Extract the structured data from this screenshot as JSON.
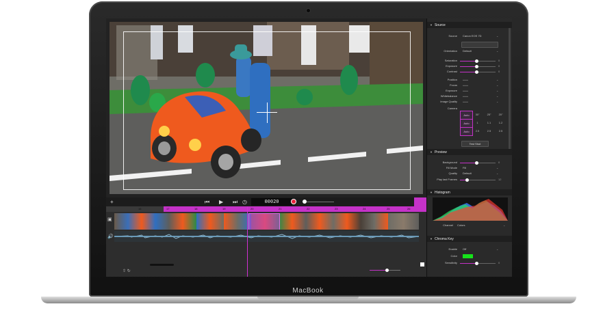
{
  "device": {
    "brand": "MacBook"
  },
  "transport": {
    "timecode": "00020",
    "prev_icon": "skip-back-icon",
    "play_icon": "play-icon",
    "next_icon": "skip-forward-icon",
    "clock_icon": "clock-icon"
  },
  "timeline": {
    "ruler_labels": [
      "16",
      "17",
      "18",
      "19",
      "20",
      "21",
      "22",
      "23",
      "24",
      "25",
      "26"
    ]
  },
  "inspector": {
    "source": {
      "title": "Source",
      "source_label": "Source",
      "source_value": "Canon EOS 7D",
      "orientation_label": "Orientation",
      "orientation_value": "Default",
      "saturation_label": "Saturation",
      "saturation_value": "0",
      "exposure_label": "Exposure",
      "exposure_value": "0",
      "contrast_label": "Contrast",
      "contrast_value": "0",
      "position_label": "Position",
      "focus_label": "Focus",
      "exposure2_label": "Exposure",
      "whitebalance_label": "Whitebalance",
      "image_quality_label": "Image Quality",
      "camera_label": "Camera",
      "camera_cells": [
        "Auto",
        "30\"",
        "25\"",
        "20\"",
        "Auto",
        "1",
        "1.1",
        "1.2",
        "Auto",
        "2.5",
        "2.5",
        "2.5"
      ],
      "test_shot": "Test Shot"
    },
    "preview": {
      "title": "Preview",
      "background_label": "Background",
      "background_value": "0",
      "fill_mode_label": "Fill Mode",
      "fill_mode_value": "Fill",
      "quality_label": "Quality",
      "quality_value": "Default",
      "play_last_label": "Play last Frames",
      "play_last_value": "12"
    },
    "histogram": {
      "title": "Histogram",
      "channel_label": "Channel",
      "channel_value": "Colors"
    },
    "chroma_key": {
      "title": "Chroma Key",
      "enable_label": "Enable",
      "enable_value": "Off",
      "color_label": "Color",
      "color_hex": "#16e21a",
      "sensitivity_label": "Sensitivity",
      "sensitivity_value": "0"
    }
  },
  "colors": {
    "accent": "#c532c8",
    "record": "#e8223b",
    "chroma": "#16e21a"
  }
}
